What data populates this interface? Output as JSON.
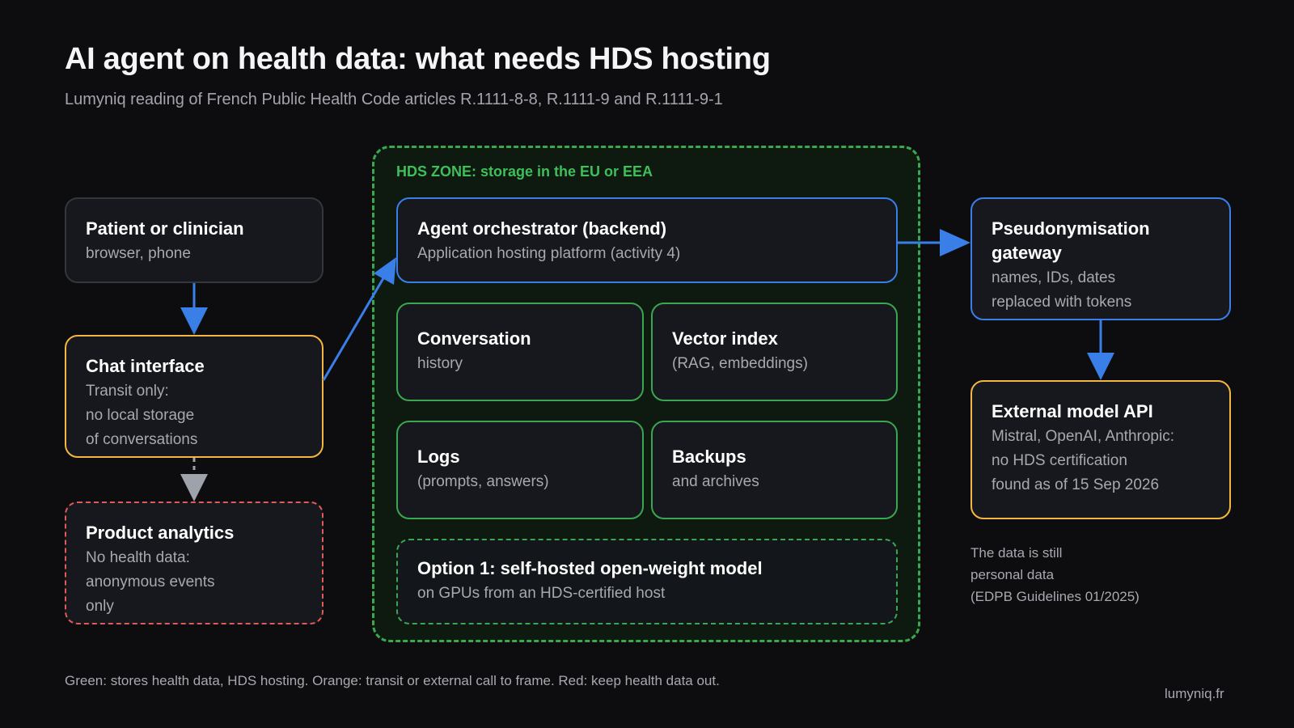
{
  "title": "AI agent on health data: what needs HDS hosting",
  "subtitle": "Lumyniq reading of French Public Health Code articles R.1111-8-8, R.1111-9 and R.1111-9-1",
  "zone": {
    "label": "HDS ZONE: storage in the EU or EEA"
  },
  "boxes": {
    "patient": {
      "title": "Patient or clinician",
      "lines": [
        "browser, phone"
      ]
    },
    "chat": {
      "title": "Chat interface",
      "lines": [
        "Transit only:",
        "no local storage",
        "of conversations"
      ]
    },
    "analytics": {
      "title": "Product analytics",
      "lines": [
        "No health data:",
        "anonymous events",
        "only"
      ]
    },
    "orchestrator": {
      "title": "Agent orchestrator (backend)",
      "lines": [
        "Application hosting platform (activity 4)"
      ]
    },
    "conversation": {
      "title": "Conversation",
      "lines": [
        "history"
      ]
    },
    "vector": {
      "title": "Vector index",
      "lines": [
        "(RAG, embeddings)"
      ]
    },
    "logs": {
      "title": "Logs",
      "lines": [
        "(prompts, answers)"
      ]
    },
    "backups": {
      "title": "Backups",
      "lines": [
        "and archives"
      ]
    },
    "option1": {
      "title": "Option 1: self-hosted open-weight model",
      "lines": [
        "on GPUs from an HDS-certified host"
      ]
    },
    "pseudo": {
      "title_lines": [
        "Pseudonymisation",
        "gateway"
      ],
      "lines": [
        "names, IDs, dates",
        "replaced with tokens"
      ]
    },
    "external": {
      "title": "External model API",
      "lines": [
        "Mistral, OpenAI, Anthropic:",
        "no HDS certification",
        "found as of 15 Sep 2026"
      ]
    }
  },
  "note": [
    "The data is still",
    "personal data",
    "(EDPB Guidelines 01/2025)"
  ],
  "legend": "Green: stores health data, HDS hosting. Orange: transit or external call to frame. Red: keep health data out.",
  "site": "lumyniq.fr",
  "colors": {
    "background": "#0d0d10",
    "green": "#3aa651",
    "orange": "#f3b642",
    "red": "#e05a57",
    "blue": "#3a7ee8",
    "gray_arrow": "#9ea3ab"
  }
}
